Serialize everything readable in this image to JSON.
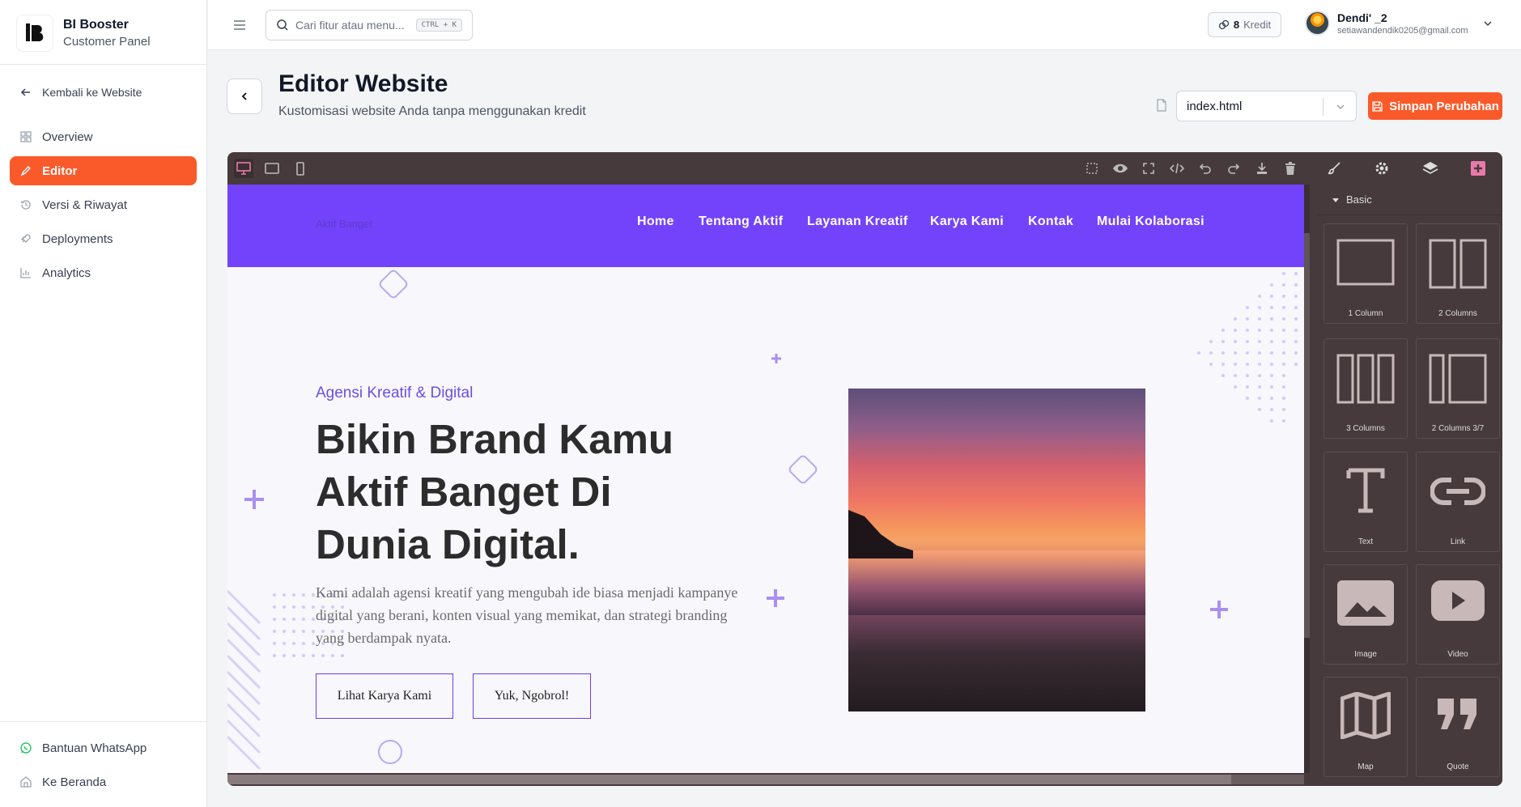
{
  "brand": {
    "name": "BI Booster",
    "subtitle": "Customer Panel"
  },
  "sidebar": {
    "back_label": "Kembali ke Website",
    "items": [
      {
        "label": "Overview",
        "icon": "grid-icon",
        "active": false
      },
      {
        "label": "Editor",
        "icon": "brush-icon",
        "active": true
      },
      {
        "label": "Versi & Riwayat",
        "icon": "history-icon",
        "active": false
      },
      {
        "label": "Deployments",
        "icon": "rocket-icon",
        "active": false
      },
      {
        "label": "Analytics",
        "icon": "bar-chart-icon",
        "active": false
      }
    ],
    "bottom": [
      {
        "label": "Bantuan WhatsApp",
        "icon": "whatsapp-icon"
      },
      {
        "label": "Ke Beranda",
        "icon": "home-icon"
      }
    ]
  },
  "header": {
    "search_placeholder": "Cari fitur atau menu...",
    "shortcut": "CTRL + K",
    "credits_value": "8",
    "credits_label": "Kredit",
    "user_name": "Dendi' _2",
    "user_email": "setiawandendik0205@gmail.com"
  },
  "page": {
    "title": "Editor Website",
    "subtitle": "Kustomisasi website Anda tanpa menggunakan kredit",
    "file_selected": "index.html",
    "save_label": "Simpan Perubahan"
  },
  "site": {
    "brand": "Aktif Banget",
    "menu": [
      "Home",
      "Tentang Aktif",
      "Layanan Kreatif",
      "Karya Kami",
      "Kontak",
      "Mulai Kolaborasi"
    ],
    "tagline": "Agensi Kreatif & Digital",
    "headline": "Bikin Brand Kamu Aktif Banget Di Dunia Digital.",
    "paragraph": "Kami adalah agensi kreatif yang mengubah ide biasa menjadi kampanye digital yang berani, konten visual yang memikat, dan strategi branding yang berdampak nyata.",
    "btn_primary": "Lihat Karya Kami",
    "btn_secondary": "Yuk, Ngobrol!"
  },
  "blocks": {
    "category": "Basic",
    "items": [
      "1 Column",
      "2 Columns",
      "3 Columns",
      "2 Columns 3/7",
      "Text",
      "Link",
      "Image",
      "Video",
      "Map",
      "Quote"
    ]
  },
  "colors": {
    "accent": "#fa5a2a",
    "site_primary": "#7343fb",
    "editor_bg": "#463a3c"
  }
}
